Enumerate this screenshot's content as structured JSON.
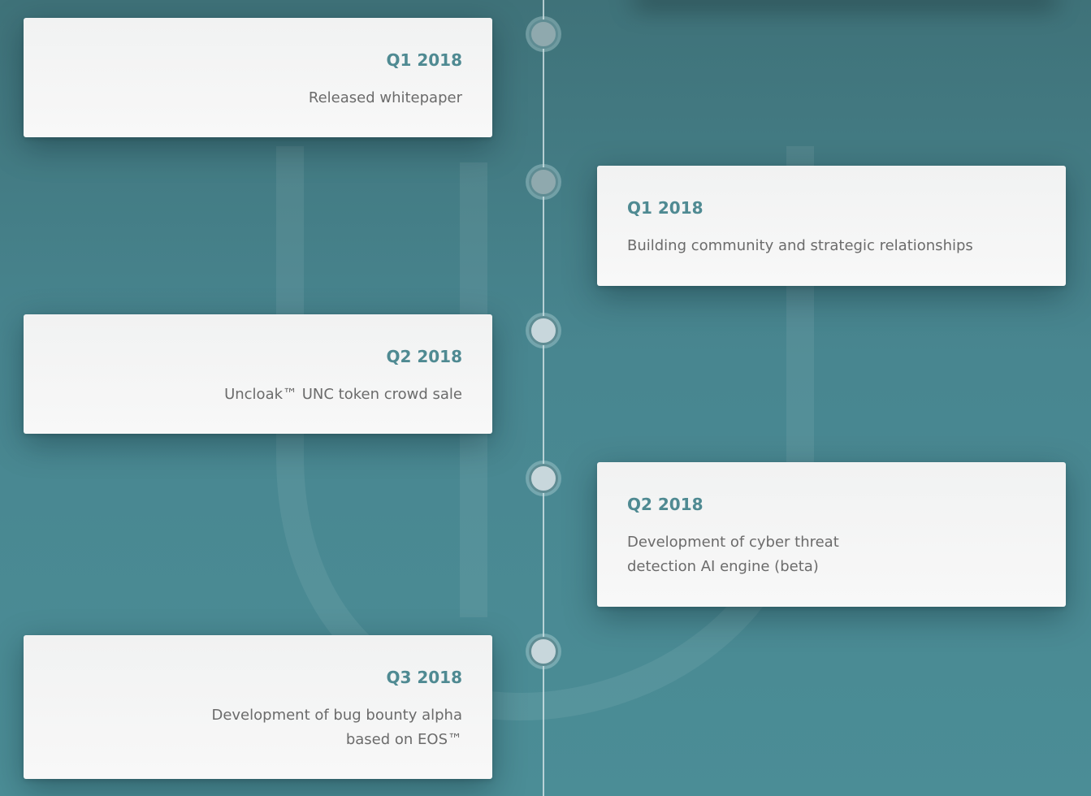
{
  "timeline": {
    "items": [
      {
        "title": "Q1 2018",
        "text": "Released whitepaper",
        "side": "left"
      },
      {
        "title": "Q1 2018",
        "text": "Building community and strategic relationships",
        "side": "right"
      },
      {
        "title": "Q2 2018",
        "text": "Uncloak™ UNC token crowd sale",
        "side": "left"
      },
      {
        "title": "Q2 2018",
        "text": "Development of cyber threat\ndetection AI engine (beta)",
        "side": "right"
      },
      {
        "title": "Q3 2018",
        "text": "Development of bug bounty alpha\nbased on EOS™",
        "side": "left"
      }
    ]
  },
  "colors": {
    "background": "#488690",
    "accent": "#4f8a92",
    "card": "#f4f4f4",
    "text": "#6b6b6b"
  }
}
